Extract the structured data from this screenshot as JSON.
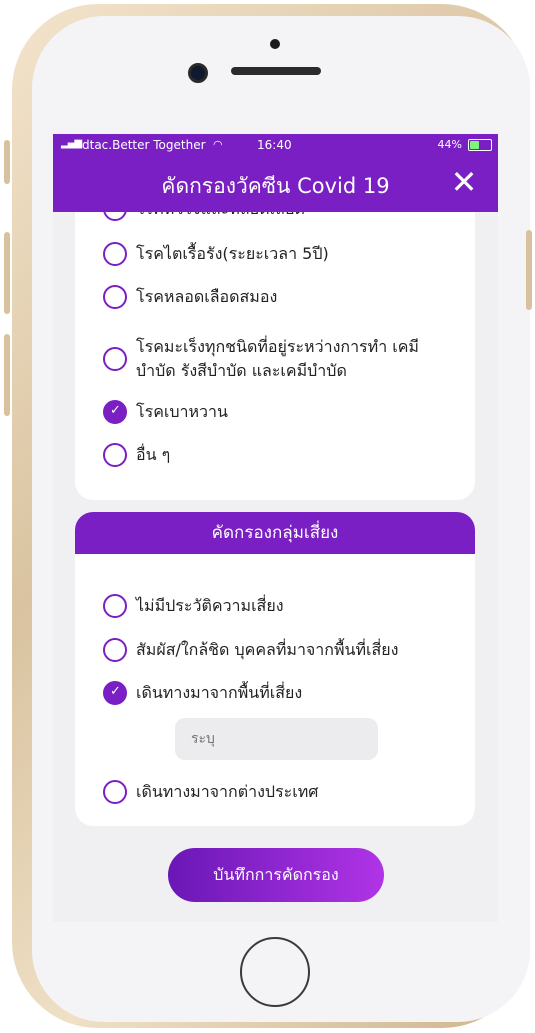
{
  "status_bar": {
    "carrier": "dtac.Better Together",
    "time": "16:40",
    "battery_text": "44%",
    "battery_level": 0.44
  },
  "header": {
    "title": "คัดกรองวัคซีน Covid 19",
    "close_icon": "✕"
  },
  "diseases": {
    "options": [
      {
        "label": "โรคหัวใจและหลอดเลือด",
        "checked": false
      },
      {
        "label": "โรคไตเรื้อรัง(ระยะเวลา 5ปี)",
        "checked": false
      },
      {
        "label": "โรคหลอดเลือดสมอง",
        "checked": false
      },
      {
        "label": "โรคมะเร็งทุกชนิดที่อยู่ระหว่างการทำ เคมีบำบัด รังสีบำบัด และเคมีบำบัด",
        "checked": false
      },
      {
        "label": "โรคเบาหวาน",
        "checked": true
      },
      {
        "label": "อื่น ๆ",
        "checked": false
      }
    ]
  },
  "risk_group": {
    "title": "คัดกรองกลุ่มเสี่ยง",
    "options": [
      {
        "label": "ไม่มีประวัติความเสี่ยง",
        "checked": false
      },
      {
        "label": "สัมผัส/ใกล้ชิด บุคคลที่มาจากพื้นที่เสี่ยง",
        "checked": false
      },
      {
        "label": "เดินทางมาจากพื้นที่เสี่ยง",
        "checked": true
      },
      {
        "label": "เดินทางมาจากต่างประเทศ",
        "checked": false
      }
    ],
    "specify_placeholder": "ระบุ"
  },
  "save_button": "บันทึกการคัดกรอง",
  "colors": {
    "accent": "#7a1fc4"
  }
}
